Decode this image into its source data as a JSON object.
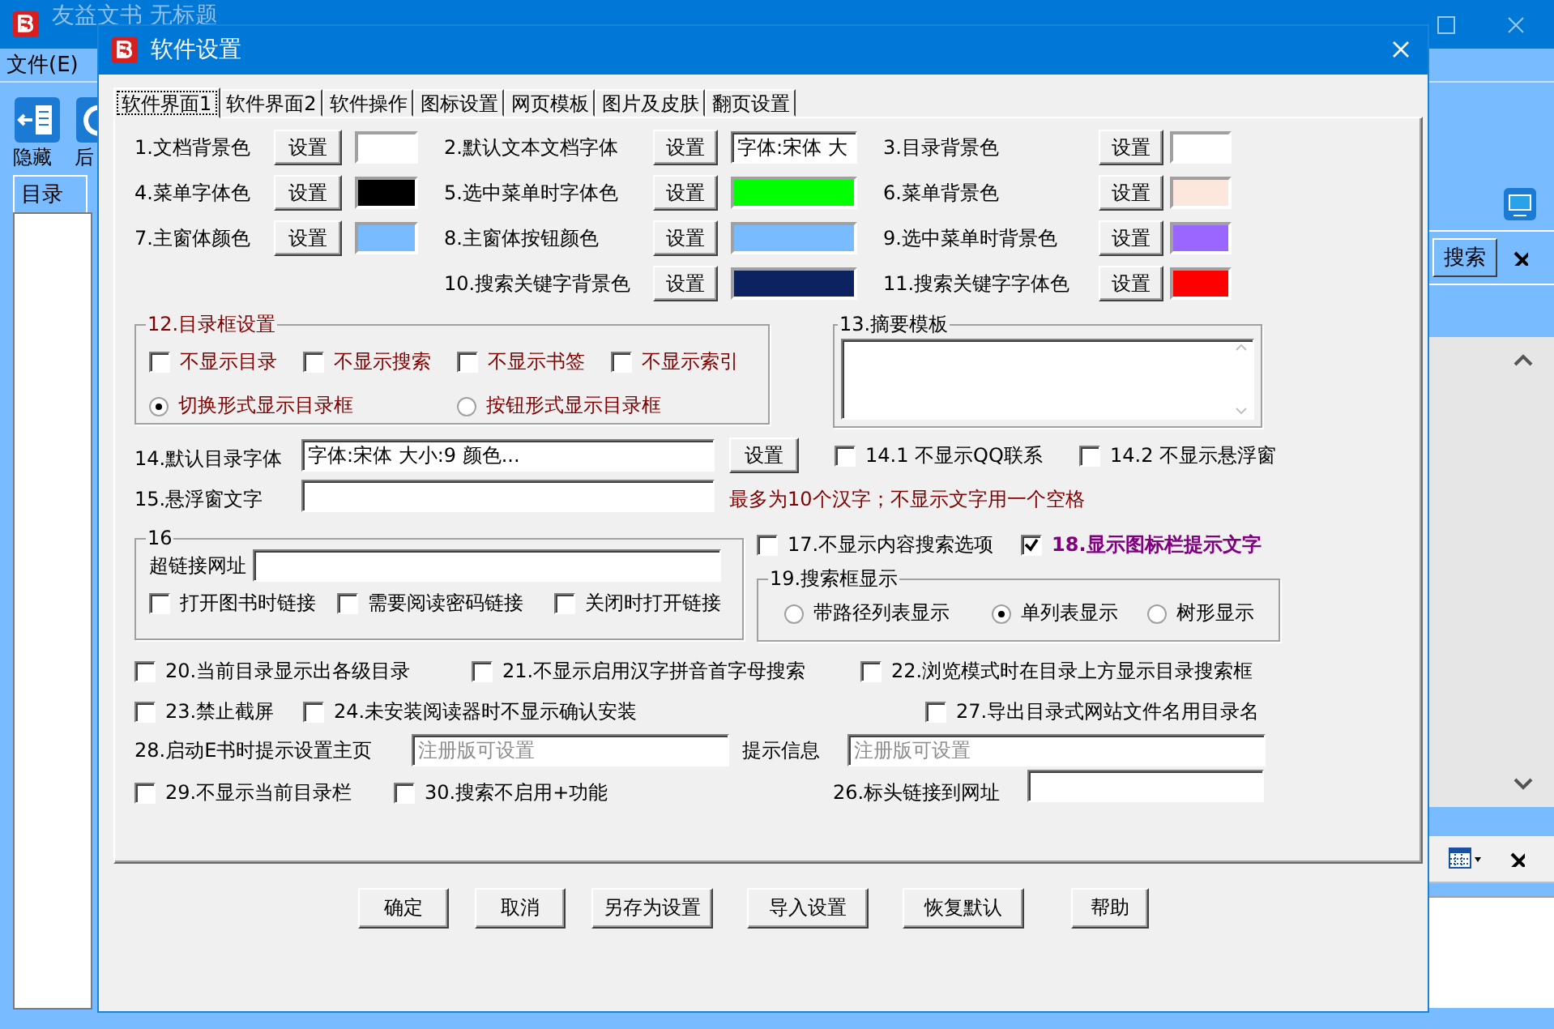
{
  "main_window": {
    "title": "友益文书 无标题",
    "menu": [
      "文件(E)"
    ],
    "toolbar": [
      "隐藏",
      "后"
    ],
    "sidebar_tab": "目录",
    "search_button": "搜索"
  },
  "dialog": {
    "title": "软件设置",
    "tabs": [
      {
        "label": "软件界面1",
        "selected": true
      },
      {
        "label": "软件界面2",
        "selected": false
      },
      {
        "label": "软件操作",
        "selected": false
      },
      {
        "label": "图标设置",
        "selected": false
      },
      {
        "label": "网页模板",
        "selected": false
      },
      {
        "label": "图片及皮肤",
        "selected": false
      },
      {
        "label": "翻页设置",
        "selected": false
      }
    ],
    "color_rows": [
      {
        "cells": [
          {
            "kind": "color",
            "label": "1.文档背景色",
            "button": "设置",
            "color": "#ffffff"
          },
          {
            "kind": "font",
            "label": "2.默认文本文档字体",
            "button": "设置",
            "value": "字体:宋体 大"
          },
          {
            "kind": "color",
            "label": "3.目录背景色",
            "button": "设置",
            "color": "#ffffff"
          }
        ]
      },
      {
        "cells": [
          {
            "kind": "color",
            "label": "4.菜单字体色",
            "button": "设置",
            "color": "#000000"
          },
          {
            "kind": "color",
            "label": "5.选中菜单时字体色",
            "button": "设置",
            "color": "#00ff00"
          },
          {
            "kind": "color",
            "label": "6.菜单背景色",
            "button": "设置",
            "color": "#fde7dd"
          }
        ]
      },
      {
        "cells": [
          {
            "kind": "color",
            "label": "7.主窗体颜色",
            "button": "设置",
            "color": "#78bbff"
          },
          {
            "kind": "color",
            "label": "8.主窗体按钮颜色",
            "button": "设置",
            "color": "#78bbff"
          },
          {
            "kind": "color",
            "label": "9.选中菜单时背景色",
            "button": "设置",
            "color": "#9966ff"
          }
        ]
      },
      {
        "cells": [
          null,
          {
            "kind": "color",
            "label": "10.搜索关键字背景色",
            "button": "设置",
            "color": "#0c2261"
          },
          {
            "kind": "color",
            "label": "11.搜索关键字字体色",
            "button": "设置",
            "color": "#ff0000"
          }
        ]
      }
    ],
    "directory_box": {
      "title": "12.目录框设置",
      "checks": [
        {
          "label": "不显示目录",
          "checked": false
        },
        {
          "label": "不显示搜索",
          "checked": false
        },
        {
          "label": "不显示书签",
          "checked": false
        },
        {
          "label": "不显示索引",
          "checked": false
        }
      ],
      "radios": [
        {
          "label": "切换形式显示目录框",
          "selected": true
        },
        {
          "label": "按钮形式显示目录框",
          "selected": false
        }
      ]
    },
    "summary_template": {
      "title": "13.摘要模板"
    },
    "default_font": {
      "label": "14.默认目录字体",
      "value": "字体:宋体  大小:9   颜色...",
      "button": "设置"
    },
    "float_checks": [
      {
        "label": "14.1 不显示QQ联系",
        "checked": false
      },
      {
        "label": "14.2 不显示悬浮窗",
        "checked": false
      }
    ],
    "float_text": {
      "label": "15.悬浮窗文字",
      "note": "最多为10个汉字；不显示文字用一个空格"
    },
    "link_group": {
      "title": "16",
      "url_label": "超链接网址",
      "checks": [
        {
          "label": "打开图书时链接",
          "checked": false
        },
        {
          "label": "需要阅读密码链接",
          "checked": false
        },
        {
          "label": "关闭时打开链接",
          "checked": false
        }
      ]
    },
    "search_checks": [
      {
        "label": "17.不显示内容搜索选项",
        "checked": false
      },
      {
        "label": "18.显示图标栏提示文字",
        "checked": true
      }
    ],
    "search_box": {
      "title": "19.搜索框显示",
      "radios": [
        {
          "label": "带路径列表显示",
          "selected": false
        },
        {
          "label": "单列表显示",
          "selected": true
        },
        {
          "label": "树形显示",
          "selected": false
        }
      ]
    },
    "option_rows": [
      {
        "checks": [
          {
            "label": "20.当前目录显示出各级目录",
            "checked": false
          },
          {
            "label": "21.不显示启用汉字拼音首字母搜索",
            "checked": false
          },
          {
            "label": "22.浏览模式时在目录上方显示目录搜索框",
            "checked": false
          }
        ]
      },
      {
        "checks": [
          {
            "label": "23.禁止截屏",
            "checked": false
          },
          {
            "label": "24.未安装阅读器时不显示确认安装",
            "checked": false
          },
          {
            "label": "27.导出目录式网站文件名用目录名",
            "checked": false
          }
        ]
      }
    ],
    "homepage": {
      "label": "28.启动E书时提示设置主页",
      "placeholder": "注册版可设置",
      "hint_label": "提示信息",
      "hint_placeholder": "注册版可设置"
    },
    "last_checks": [
      {
        "label": "29.不显示当前目录栏",
        "checked": false
      },
      {
        "label": "30.搜索不启用+功能",
        "checked": false
      }
    ],
    "header_link": {
      "label": "26.标头链接到网址"
    },
    "buttons": [
      "确定",
      "取消",
      "另存为设置",
      "导入设置",
      "恢复默认",
      "帮助"
    ]
  }
}
